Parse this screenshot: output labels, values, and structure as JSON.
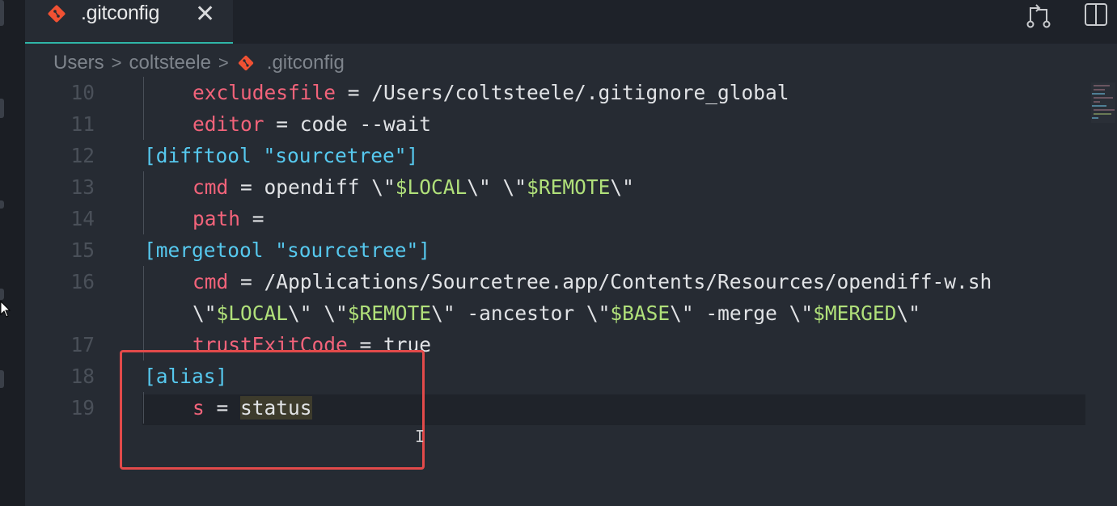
{
  "tab": {
    "title": ".gitconfig",
    "close_glyph": "✕",
    "icon": "git-logo-icon"
  },
  "breadcrumb": {
    "items": [
      "Users",
      "coltsteele",
      ".gitconfig"
    ],
    "separator": ">"
  },
  "toolbar": {
    "compare_icon": "open-changes-icon",
    "split_icon": "split-editor-icon"
  },
  "colors": {
    "accent": "#2fb6a8",
    "git": "#f05133",
    "keyword": "#f2637a",
    "section": "#56c8ee",
    "variable": "#b0e07a",
    "highlight_box": "#e24a4a"
  },
  "editor": {
    "lines": [
      {
        "num": "10",
        "indent": 1,
        "tokens": [
          [
            "key",
            "excludesfile"
          ],
          [
            "op",
            " = /Users/coltsteele/.gitignore_global"
          ]
        ]
      },
      {
        "num": "11",
        "indent": 1,
        "tokens": [
          [
            "key",
            "editor"
          ],
          [
            "op",
            " = code --wait"
          ]
        ]
      },
      {
        "num": "12",
        "indent": 0,
        "tokens": [
          [
            "sec",
            "[difftool \"sourcetree\"]"
          ]
        ]
      },
      {
        "num": "13",
        "indent": 1,
        "tokens": [
          [
            "key",
            "cmd"
          ],
          [
            "op",
            " = opendiff \\\""
          ],
          [
            "var",
            "$LOCAL"
          ],
          [
            "op",
            "\\\" \\\""
          ],
          [
            "var",
            "$REMOTE"
          ],
          [
            "op",
            "\\\""
          ]
        ]
      },
      {
        "num": "14",
        "indent": 1,
        "tokens": [
          [
            "key",
            "path"
          ],
          [
            "op",
            " ="
          ]
        ]
      },
      {
        "num": "15",
        "indent": 0,
        "tokens": [
          [
            "sec",
            "[mergetool \"sourcetree\"]"
          ]
        ]
      },
      {
        "num": "16",
        "indent": 1,
        "tokens": [
          [
            "key",
            "cmd"
          ],
          [
            "op",
            " = /Applications/Sourcetree.app/Contents/Resources/opendiff-w.sh"
          ]
        ]
      },
      {
        "num": "",
        "indent": 1,
        "tokens": [
          [
            "op",
            "\\\""
          ],
          [
            "var",
            "$LOCAL"
          ],
          [
            "op",
            "\\\" \\\""
          ],
          [
            "var",
            "$REMOTE"
          ],
          [
            "op",
            "\\\" -ancestor \\\""
          ],
          [
            "var",
            "$BASE"
          ],
          [
            "op",
            "\\\" -merge \\\""
          ],
          [
            "var",
            "$MERGED"
          ],
          [
            "op",
            "\\\""
          ]
        ]
      },
      {
        "num": "17",
        "indent": 1,
        "tokens": [
          [
            "key",
            "trustExitCode"
          ],
          [
            "op",
            " = true"
          ]
        ]
      },
      {
        "num": "18",
        "indent": 0,
        "tokens": [
          [
            "sec",
            "[alias]"
          ]
        ]
      },
      {
        "num": "19",
        "indent": 1,
        "tokens": [
          [
            "key",
            "s"
          ],
          [
            "op",
            " = "
          ],
          [
            "hl",
            "status"
          ]
        ]
      }
    ]
  }
}
